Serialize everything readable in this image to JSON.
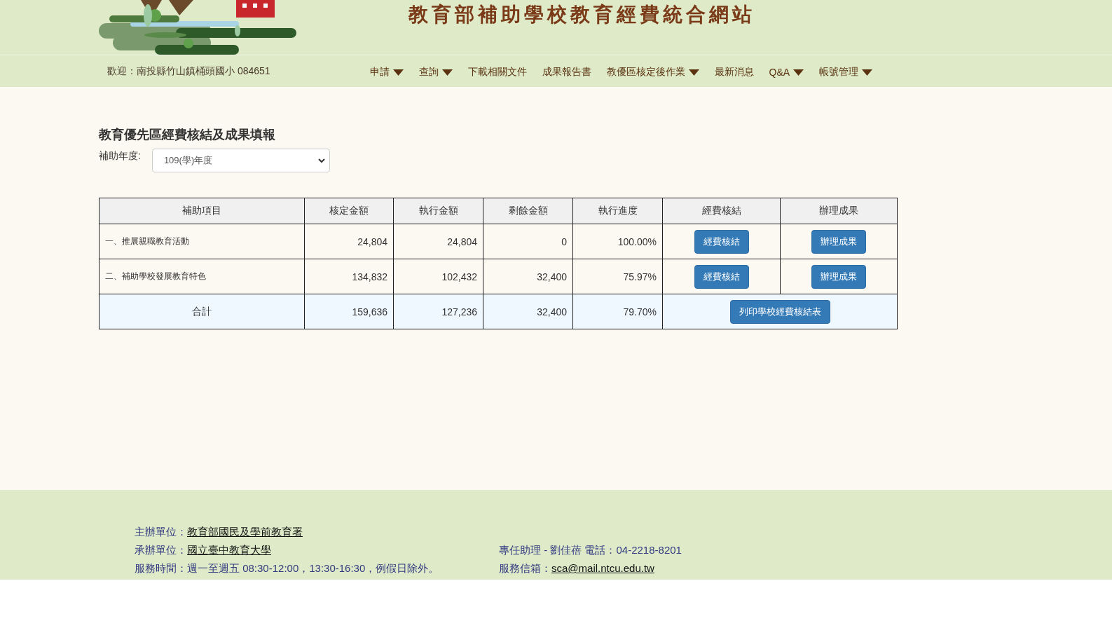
{
  "header": {
    "title": "教育部補助學校教育經費統合網站"
  },
  "nav": {
    "welcome": "歡迎：南投縣竹山鎮桶頭國小 084651",
    "items": [
      {
        "label": "申請",
        "dropdown": true
      },
      {
        "label": "查詢",
        "dropdown": true
      },
      {
        "label": "下載相關文件",
        "dropdown": false
      },
      {
        "label": "成果報告書",
        "dropdown": false
      },
      {
        "label": "教優區核定後作業",
        "dropdown": true
      },
      {
        "label": "最新消息",
        "dropdown": false
      },
      {
        "label": "Q&A",
        "dropdown": true
      },
      {
        "label": "帳號管理",
        "dropdown": true
      }
    ]
  },
  "page": {
    "heading": "教育優先區經費核結及成果填報",
    "year_label": "補助年度:",
    "year_value": "109(學)年度"
  },
  "table": {
    "columns": [
      "補助項目",
      "核定金額",
      "執行金額",
      "剩餘金額",
      "執行進度",
      "經費核結",
      "辦理成果"
    ],
    "rows": [
      {
        "cells": [
          "一、推展親職教育活動",
          "24,804",
          "24,804",
          "0",
          "100.00%"
        ],
        "buttons": [
          "經費核結",
          "辦理成果"
        ]
      },
      {
        "cells": [
          "二、補助學校發展教育特色",
          "134,832",
          "102,432",
          "32,400",
          "75.97%"
        ],
        "buttons": [
          "經費核結",
          "辦理成果"
        ]
      }
    ],
    "total": {
      "label": "合計",
      "cells": [
        "159,636",
        "127,236",
        "32,400",
        "79.70%"
      ],
      "button": "列印學校經費核結表"
    }
  },
  "footer": {
    "left": [
      {
        "label": "主辦單位：",
        "link": "教育部國民及學前教育署"
      },
      {
        "label": "承辦單位：",
        "link": "國立臺中教育大學"
      },
      {
        "label": "服務時間：週一至週五 08:30-12:00，13:30-16:30，例假日除外。"
      }
    ],
    "right": [
      {
        "label": "專任助理 - 劉佳蓓 電話：04-2218-8201"
      },
      {
        "label": "服務信箱：",
        "link": "sca@mail.ntcu.edu.tw"
      }
    ]
  }
}
